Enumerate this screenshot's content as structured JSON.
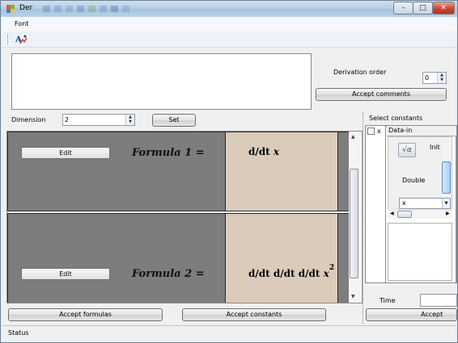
{
  "window": {
    "title": "Der",
    "minimize_label": "–",
    "maximize_label": "□",
    "close_label": "✕"
  },
  "menu": {
    "font": "Font"
  },
  "toolbar": {
    "icon": "formula-tool-icon"
  },
  "derivation": {
    "label": "Derivation order",
    "value": "0"
  },
  "buttons": {
    "accept_comments": "Accept comments",
    "set": "Set",
    "accept_formulas": "Accept formulas",
    "accept_constants": "Accept constants",
    "accept_data": "Accept data"
  },
  "dimension": {
    "label": "Dimension",
    "value": "2"
  },
  "formulas": [
    {
      "edit_label": "Edit",
      "title": "Formula 1 =",
      "op": "d/dt",
      "var": "x",
      "exponent": ""
    },
    {
      "edit_label": "Edit",
      "title": "Formula 2 =",
      "op": "d/dt  d/dt  d/dt",
      "var": "x",
      "exponent": "2"
    }
  ],
  "constants": {
    "label": "Select constants",
    "checkbox_label": "x",
    "data_in": "Data-in",
    "sqrt_glyph": "√α",
    "init": "Init",
    "type": "Double",
    "selected_var": "x"
  },
  "time": {
    "label": "Time"
  },
  "status": {
    "text": "Status"
  },
  "colors": {
    "formula_left": "#7d7d7d",
    "formula_right": "#dacbbb",
    "window_bg": "#f0f0f0"
  }
}
